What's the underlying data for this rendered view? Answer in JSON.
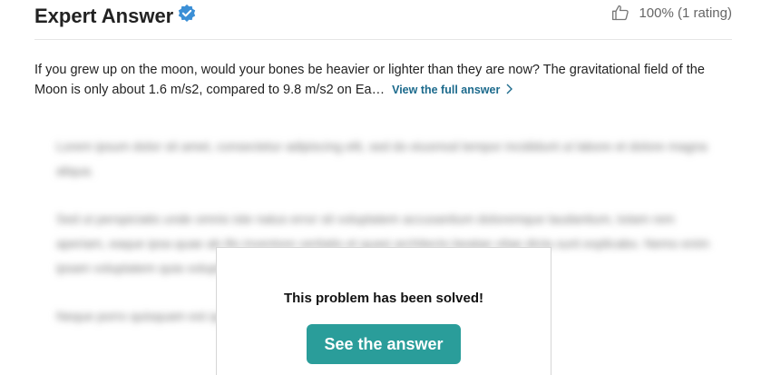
{
  "header": {
    "title": "Expert Answer",
    "verified_icon": "verified-badge-icon",
    "rating_icon": "thumbs-up-icon",
    "rating_text": "100% (1 rating)"
  },
  "question": {
    "text": "If you grew up on the moon, would your bones be heavier or lighter than they are now? The gravitational field of the Moon is only about 1.6 m/s2, compared to 9.8 m/s2 on Ea…",
    "view_link": "View the full answer"
  },
  "overlay": {
    "message": "This problem has been solved!",
    "button_label": "See the answer"
  },
  "colors": {
    "accent": "#2a9d9a",
    "link": "#1c6a8c",
    "badge": "#3b8fd6"
  }
}
